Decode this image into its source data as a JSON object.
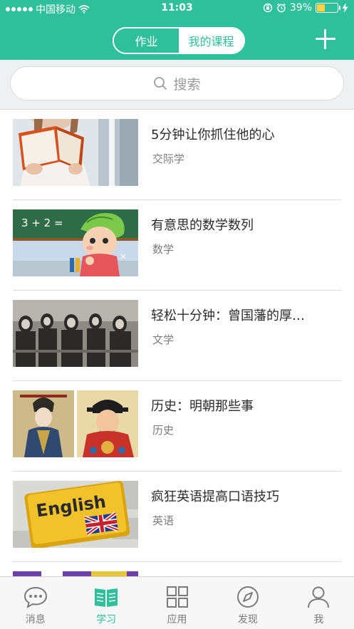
{
  "status_bar": {
    "carrier": "中国移动",
    "time": "11:03",
    "battery": "39%",
    "battery_level": 0.39,
    "signal_bars": 5
  },
  "header": {
    "tabs": [
      {
        "label": "作业",
        "selected": false
      },
      {
        "label": "我的课程",
        "selected": true
      }
    ],
    "add_icon": "plus-icon"
  },
  "search": {
    "placeholder": "搜索",
    "icon": "search-icon"
  },
  "courses": [
    {
      "title": "5分钟让你抓住他的心",
      "category": "交际学"
    },
    {
      "title": "有意思的数学数列",
      "category": "数学"
    },
    {
      "title": "轻松十分钟：曾国藩的厚…",
      "category": "文学"
    },
    {
      "title": "历史：明朝那些事",
      "category": "历史"
    },
    {
      "title": "疯狂英语提高口语技巧",
      "category": "英语"
    }
  ],
  "thumb_texts": {
    "math": "3 + 2 =",
    "english": "English"
  },
  "tabbar": [
    {
      "label": "消息",
      "icon": "chat-icon",
      "active": false
    },
    {
      "label": "学习",
      "icon": "book-icon",
      "active": true
    },
    {
      "label": "应用",
      "icon": "grid-icon",
      "active": false
    },
    {
      "label": "发现",
      "icon": "compass-icon",
      "active": false
    },
    {
      "label": "我",
      "icon": "user-icon",
      "active": false
    }
  ],
  "colors": {
    "accent": "#2fbf9a",
    "background": "#eef0f1"
  }
}
